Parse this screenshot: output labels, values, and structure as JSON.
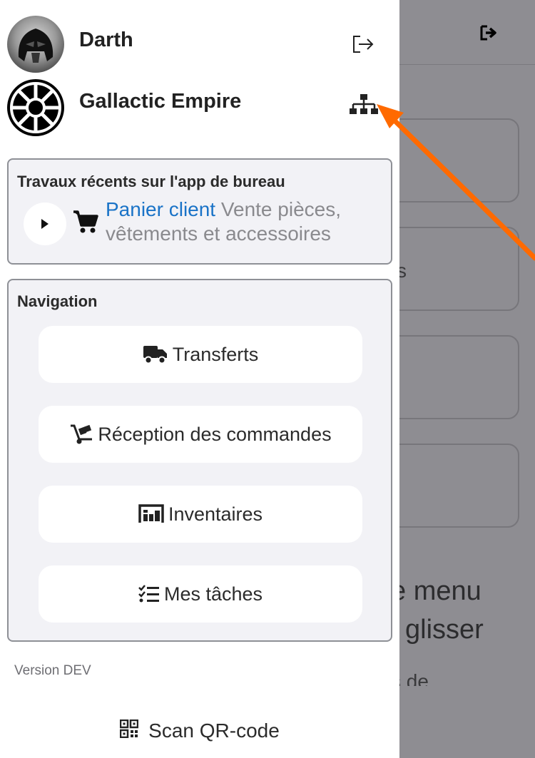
{
  "user": {
    "name": "Darth",
    "avatar_icon": "user-avatar"
  },
  "organization": {
    "name": "Gallactic Empire",
    "logo_icon": "org-logo"
  },
  "recent": {
    "title": "Travaux récents sur l'app de bureau",
    "item": {
      "link_label": "Panier client",
      "description": " Vente pièces, vêtements et accessoires"
    }
  },
  "navigation": {
    "title": "Navigation",
    "items": [
      {
        "label": "Transferts",
        "icon": "truck-icon"
      },
      {
        "label": "Réception des commandes",
        "icon": "dolly-icon"
      },
      {
        "label": "Inventaires",
        "icon": "warehouse-icon"
      },
      {
        "label": "Mes tâches",
        "icon": "tasks-icon"
      }
    ]
  },
  "version": "Version DEV",
  "scan": {
    "label": "Scan QR-code",
    "icon": "qrcode-icon"
  },
  "background": {
    "partial_text_1": "e menu",
    "partial_text_2": "glisser",
    "partial_text_3": "s de",
    "partial_text_4": "s"
  },
  "colors": {
    "accent_link": "#1a73c7",
    "arrow": "#ff6a00",
    "overlay": "#8e8d92"
  }
}
